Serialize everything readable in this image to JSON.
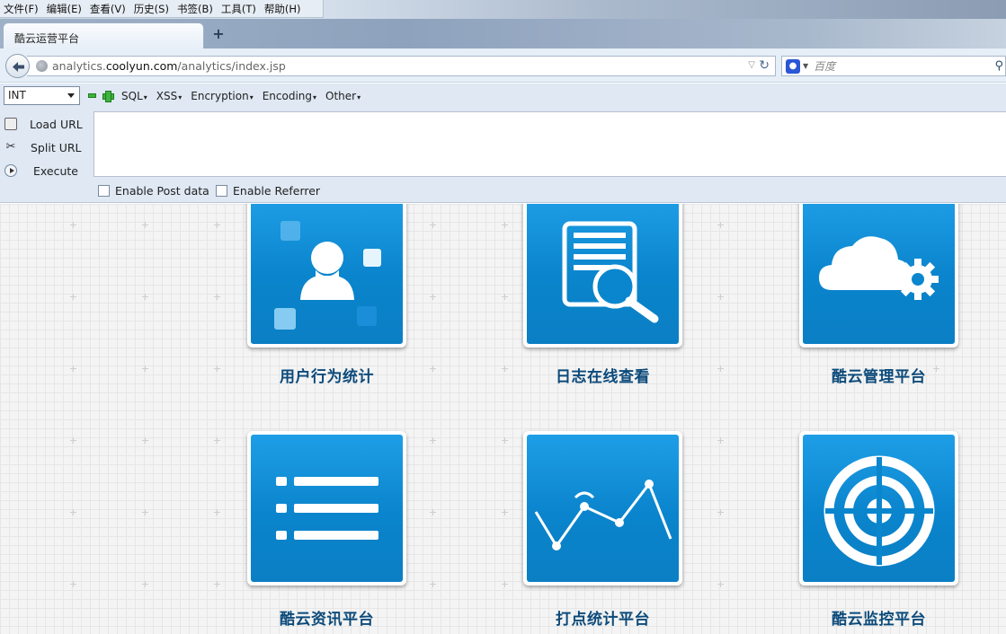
{
  "menubar": {
    "items": [
      "文件(F)",
      "编辑(E)",
      "查看(V)",
      "历史(S)",
      "书签(B)",
      "工具(T)",
      "帮助(H)"
    ]
  },
  "tabs": [
    {
      "label": "酷云运营平台"
    }
  ],
  "newtab_symbol": "+",
  "navbar": {
    "url_prefix": "analytics.",
    "url_domain": "coolyun.com",
    "url_path": "/analytics/index.jsp",
    "search_placeholder": "百度"
  },
  "hackbar": {
    "select_value": "INT",
    "menus": [
      "SQL",
      "XSS",
      "Encryption",
      "Encoding",
      "Other"
    ],
    "actions": [
      {
        "label": "Load URL",
        "icon": "load-url-icon"
      },
      {
        "label": "Split URL",
        "icon": "scissors-icon"
      },
      {
        "label": "Execute",
        "icon": "play-icon"
      }
    ],
    "textarea_value": "",
    "checkboxes": [
      {
        "label": "Enable Post data",
        "checked": false
      },
      {
        "label": "Enable Referrer",
        "checked": false
      }
    ]
  },
  "tiles": [
    {
      "label": "用户行为统计",
      "icon": "user-behavior-icon"
    },
    {
      "label": "日志在线查看",
      "icon": "log-search-icon"
    },
    {
      "label": "酷云管理平台",
      "icon": "cloud-gear-icon"
    },
    {
      "label": "酷云资讯平台",
      "icon": "list-icon"
    },
    {
      "label": "打点统计平台",
      "icon": "line-chart-icon"
    },
    {
      "label": "酷云监控平台",
      "icon": "target-icon"
    }
  ],
  "colors": {
    "tile_blue": "#0a8ad6",
    "tile_label": "#0c4a7a"
  }
}
